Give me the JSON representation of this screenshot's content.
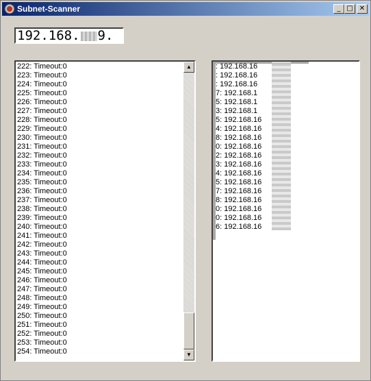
{
  "window": {
    "title": "Subnet-Scanner"
  },
  "titlebar_buttons": {
    "minimize": "_",
    "maximize": "□",
    "close": "✕"
  },
  "ip_field": {
    "prefix": "192.168.",
    "suffix": "9."
  },
  "left_list": {
    "items": [
      "222: Timeout:0",
      "223: Timeout:0",
      "224: Timeout:0",
      "225: Timeout:0",
      "226: Timeout:0",
      "227: Timeout:0",
      "228: Timeout:0",
      "229: Timeout:0",
      "230: Timeout:0",
      "231: Timeout:0",
      "232: Timeout:0",
      "233: Timeout:0",
      "234: Timeout:0",
      "235: Timeout:0",
      "236: Timeout:0",
      "237: Timeout:0",
      "238: Timeout:0",
      "239: Timeout:0",
      "240: Timeout:0",
      "241: Timeout:0",
      "242: Timeout:0",
      "243: Timeout:0",
      "244: Timeout:0",
      "245: Timeout:0",
      "246: Timeout:0",
      "247: Timeout:0",
      "248: Timeout:0",
      "249: Timeout:0",
      "250: Timeout:0",
      "251: Timeout:0",
      "252: Timeout:0",
      "253: Timeout:0",
      "254: Timeout:0"
    ]
  },
  "right_list": {
    "items": [
      ": 192.168.16",
      ": 192.168.16",
      ": 192.168.16",
      "7: 192.168.1",
      "5: 192.168.1",
      "3: 192.168.1",
      "5: 192.168.16",
      "4: 192.168.16",
      "8: 192.168.16",
      "0: 192.168.16",
      "2: 192.168.16",
      "3: 192.168.16",
      "4: 192.168.16",
      "5: 192.168.16",
      "7: 192.168.16",
      "8: 192.168.16",
      "0: 192.168.16",
      "0: 192.168.16",
      "6: 192.168.16"
    ]
  },
  "scrollbar": {
    "up_arrow": "▲",
    "down_arrow": "▼"
  }
}
